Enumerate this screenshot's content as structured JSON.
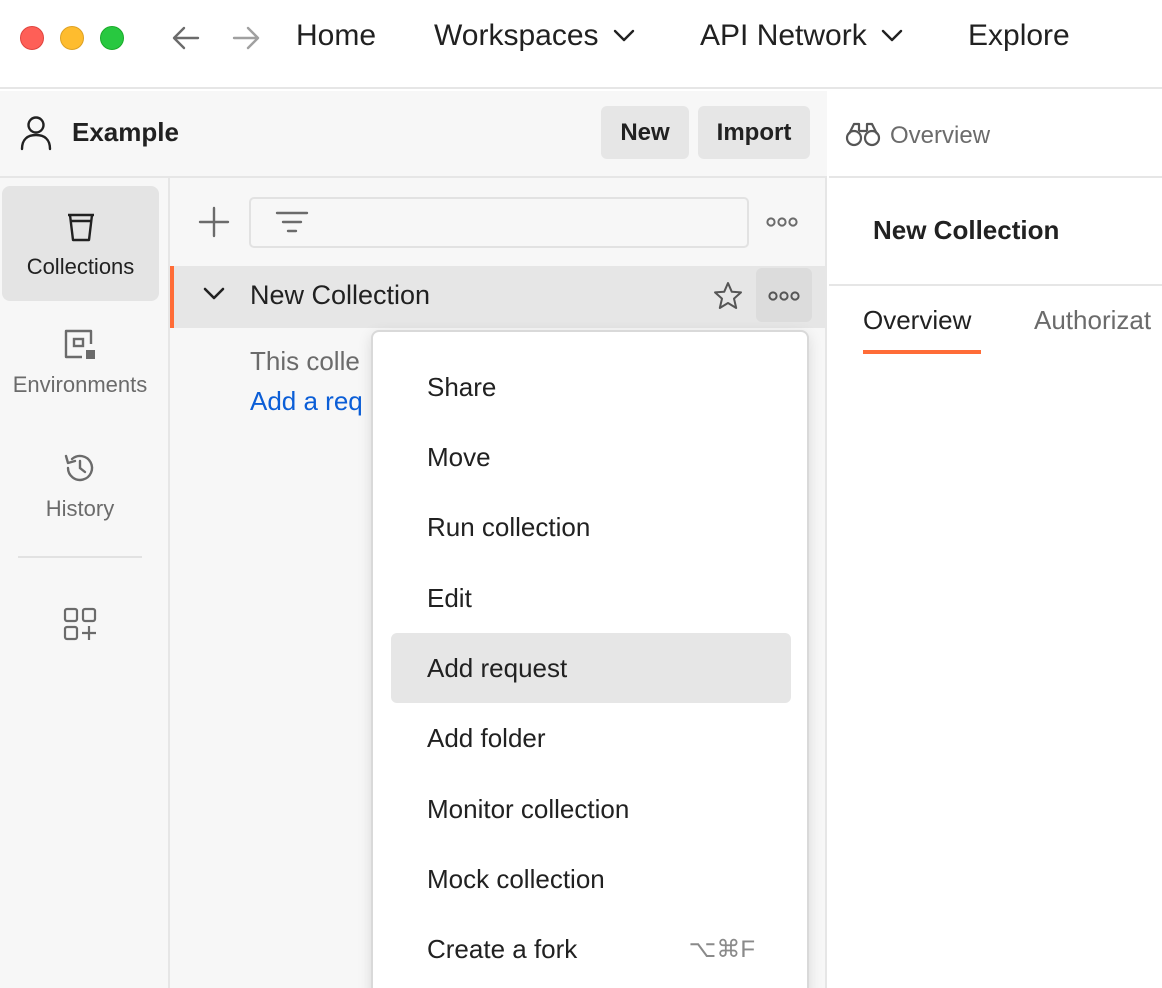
{
  "titlebar": {
    "nav": {
      "back_icon": "arrow-left-icon",
      "forward_icon": "arrow-right-icon"
    },
    "items": [
      {
        "label": "Home"
      },
      {
        "label": "Workspaces",
        "has_dropdown": true
      },
      {
        "label": "API Network",
        "has_dropdown": true
      },
      {
        "label": "Explore"
      }
    ]
  },
  "workspace": {
    "name": "Example",
    "new_label": "New",
    "import_label": "Import"
  },
  "sidebar": {
    "items": [
      {
        "label": "Collections",
        "icon": "trash-can-icon",
        "active": true
      },
      {
        "label": "Environments",
        "icon": "environment-icon"
      },
      {
        "label": "History",
        "icon": "history-icon"
      },
      {
        "label": "",
        "icon": "apps-add-icon"
      }
    ]
  },
  "collections": {
    "search_placeholder": "",
    "tree": [
      {
        "name": "New Collection",
        "expanded": true
      }
    ],
    "empty_text": "This colle",
    "add_request_link": "Add a req"
  },
  "context_menu": {
    "items": [
      {
        "label": "Share"
      },
      {
        "label": "Move"
      },
      {
        "label": "Run collection"
      },
      {
        "label": "Edit"
      },
      {
        "label": "Add request",
        "highlighted": true
      },
      {
        "label": "Add folder"
      },
      {
        "label": "Monitor collection"
      },
      {
        "label": "Mock collection"
      },
      {
        "label": "Create a fork",
        "shortcut": "⌥⌘F"
      }
    ]
  },
  "right_panel": {
    "tab_label": "Overview",
    "title": "New Collection",
    "tabs": [
      {
        "label": "Overview",
        "active": true
      },
      {
        "label": "Authorizat"
      }
    ]
  },
  "colors": {
    "accent": "#ff6c37",
    "link": "#0b5ed7",
    "traffic_red": "#fe5f57",
    "traffic_yellow": "#febc2e",
    "traffic_green": "#28c840"
  }
}
